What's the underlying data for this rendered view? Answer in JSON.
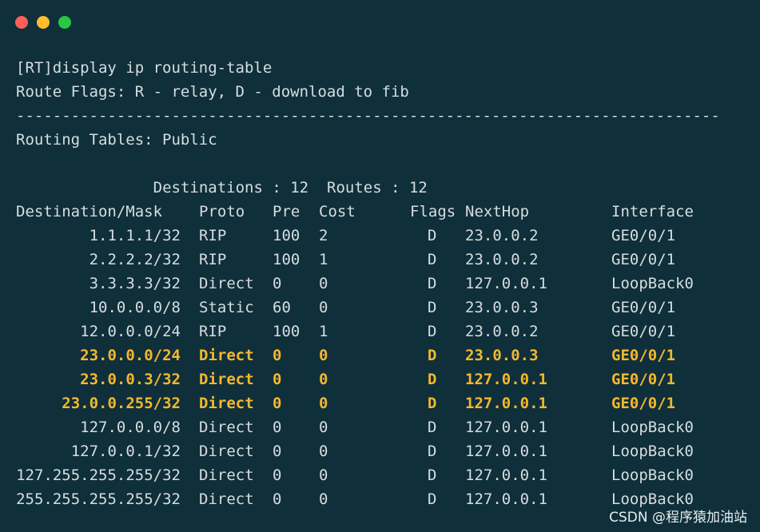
{
  "window": {
    "colors": {
      "background": "#0f2f3a",
      "text": "#d6dde0",
      "highlight": "#f5b82e",
      "close": "#ff5f57",
      "minimize": "#febc2e",
      "maximize": "#28c840"
    }
  },
  "terminal": {
    "command": "[RT]display ip routing-table",
    "route_flags": "Route Flags: R - relay, D - download to fib",
    "separator": "-----------------------------------------------------------------------------",
    "routing_tables": "Routing Tables: Public",
    "destinations_label": "Destinations : 12",
    "routes_label": "Routes : 12",
    "headers": {
      "destination": "Destination/Mask",
      "proto": "Proto",
      "pre": "Pre",
      "cost": "Cost",
      "flags": "Flags",
      "nexthop": "NextHop",
      "interface": "Interface"
    },
    "rows": [
      {
        "destination": "1.1.1.1/32",
        "proto": "RIP",
        "pre": "100",
        "cost": "2",
        "flags": "D",
        "nexthop": "23.0.0.2",
        "interface": "GE0/0/1"
      },
      {
        "destination": "2.2.2.2/32",
        "proto": "RIP",
        "pre": "100",
        "cost": "1",
        "flags": "D",
        "nexthop": "23.0.0.2",
        "interface": "GE0/0/1"
      },
      {
        "destination": "3.3.3.3/32",
        "proto": "Direct",
        "pre": "0",
        "cost": "0",
        "flags": "D",
        "nexthop": "127.0.0.1",
        "interface": "LoopBack0"
      },
      {
        "destination": "10.0.0.0/8",
        "proto": "Static",
        "pre": "60",
        "cost": "0",
        "flags": "D",
        "nexthop": "23.0.0.3",
        "interface": "GE0/0/1"
      },
      {
        "destination": "12.0.0.0/24",
        "proto": "RIP",
        "pre": "100",
        "cost": "1",
        "flags": "D",
        "nexthop": "23.0.0.2",
        "interface": "GE0/0/1"
      },
      {
        "destination": "23.0.0.0/24",
        "proto": "Direct",
        "pre": "0",
        "cost": "0",
        "flags": "D",
        "nexthop": "23.0.0.3",
        "interface": "GE0/0/1",
        "highlight": true
      },
      {
        "destination": "23.0.0.3/32",
        "proto": "Direct",
        "pre": "0",
        "cost": "0",
        "flags": "D",
        "nexthop": "127.0.0.1",
        "interface": "GE0/0/1",
        "highlight": true
      },
      {
        "destination": "23.0.0.255/32",
        "proto": "Direct",
        "pre": "0",
        "cost": "0",
        "flags": "D",
        "nexthop": "127.0.0.1",
        "interface": "GE0/0/1",
        "highlight": true
      },
      {
        "destination": "127.0.0.0/8",
        "proto": "Direct",
        "pre": "0",
        "cost": "0",
        "flags": "D",
        "nexthop": "127.0.0.1",
        "interface": "LoopBack0"
      },
      {
        "destination": "127.0.0.1/32",
        "proto": "Direct",
        "pre": "0",
        "cost": "0",
        "flags": "D",
        "nexthop": "127.0.0.1",
        "interface": "LoopBack0"
      },
      {
        "destination": "127.255.255.255/32",
        "proto": "Direct",
        "pre": "0",
        "cost": "0",
        "flags": "D",
        "nexthop": "127.0.0.1",
        "interface": "LoopBack0"
      },
      {
        "destination": "255.255.255.255/32",
        "proto": "Direct",
        "pre": "0",
        "cost": "0",
        "flags": "D",
        "nexthop": "127.0.0.1",
        "interface": "LoopBack0"
      }
    ]
  },
  "watermark": "CSDN @程序猿加油站"
}
